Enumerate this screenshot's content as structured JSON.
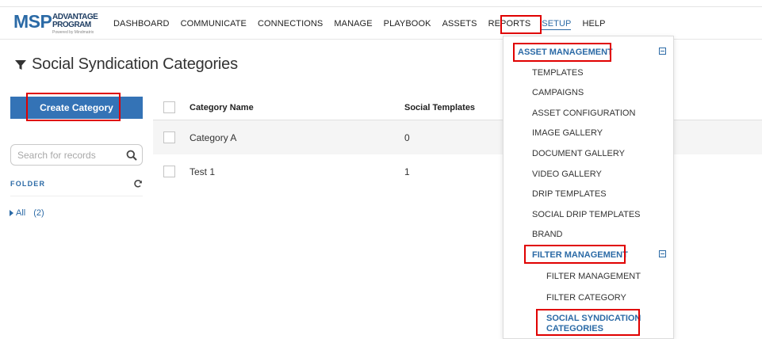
{
  "logo": {
    "msp": "MSP",
    "line1": "ADVANTAGE",
    "line2": "PROGRAM",
    "tagline": "Powered by Mindmatrix"
  },
  "nav": {
    "items": [
      "DASHBOARD",
      "COMMUNICATE",
      "CONNECTIONS",
      "MANAGE",
      "PLAYBOOK",
      "ASSETS",
      "REPORTS",
      "SETUP",
      "HELP"
    ],
    "active": "SETUP"
  },
  "page": {
    "title": "Social Syndication Categories"
  },
  "left_panel": {
    "create_button": "Create Category",
    "search_placeholder": "Search for records",
    "folder_label": "FOLDER",
    "all_label": "All",
    "all_count": "(2)"
  },
  "table": {
    "columns": [
      "Category Name",
      "Social Templates"
    ],
    "rows": [
      {
        "name": "Category A",
        "templates": "0"
      },
      {
        "name": "Test 1",
        "templates": "1"
      }
    ]
  },
  "setup_menu": {
    "asset_management": "ASSET MANAGEMENT",
    "asset_items": [
      "TEMPLATES",
      "CAMPAIGNS",
      "ASSET CONFIGURATION",
      "IMAGE GALLERY",
      "DOCUMENT GALLERY",
      "VIDEO GALLERY",
      "DRIP TEMPLATES",
      "SOCIAL DRIP TEMPLATES",
      "BRAND"
    ],
    "filter_management": "FILTER MANAGEMENT",
    "filter_items": [
      "FILTER MANAGEMENT",
      "FILTER CATEGORY"
    ],
    "active_item_line1": "SOCIAL SYNDICATION",
    "active_item_line2": "CATEGORIES"
  },
  "colors": {
    "accent": "#2b6aa6",
    "button": "#3473b6",
    "highlight": "#e00000"
  }
}
